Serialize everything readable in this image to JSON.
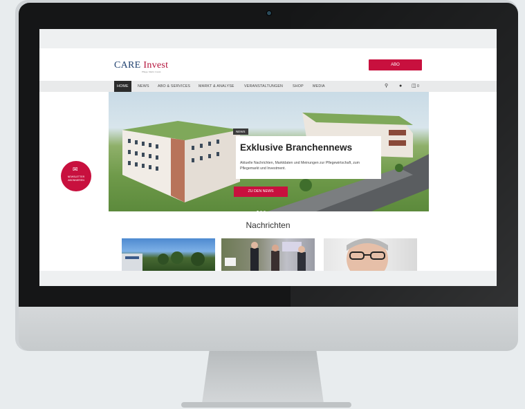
{
  "site": {
    "logo_main": "CARE",
    "logo_accent": "Invest",
    "logo_tagline": "Pflege. Markt. Invest.",
    "abo_label": "ABO"
  },
  "nav": {
    "items": [
      "HOME",
      "NEWS",
      "ABO & SERVICES",
      "MARKT & ANALYSE",
      "VERANSTALTUNGEN",
      "SHOP",
      "MEDIA"
    ],
    "cart_count": "0"
  },
  "hero": {
    "tag": "NEWS",
    "title": "Exklusive Branchennews",
    "text": "Aktuelle Nachrichten, Marktdaten und Meinungen zur Pflegewirtschaft, zum Pflegemarkt und Investment.",
    "button_label": "ZU DEN NEWS"
  },
  "newsletter": {
    "label": "NEWSLETTER ABONNIEREN"
  },
  "section": {
    "title": "Nachrichten"
  },
  "colors": {
    "brand_red": "#c8103e",
    "brand_blue": "#1d3f6e",
    "nav_active": "#2b2b2b"
  }
}
